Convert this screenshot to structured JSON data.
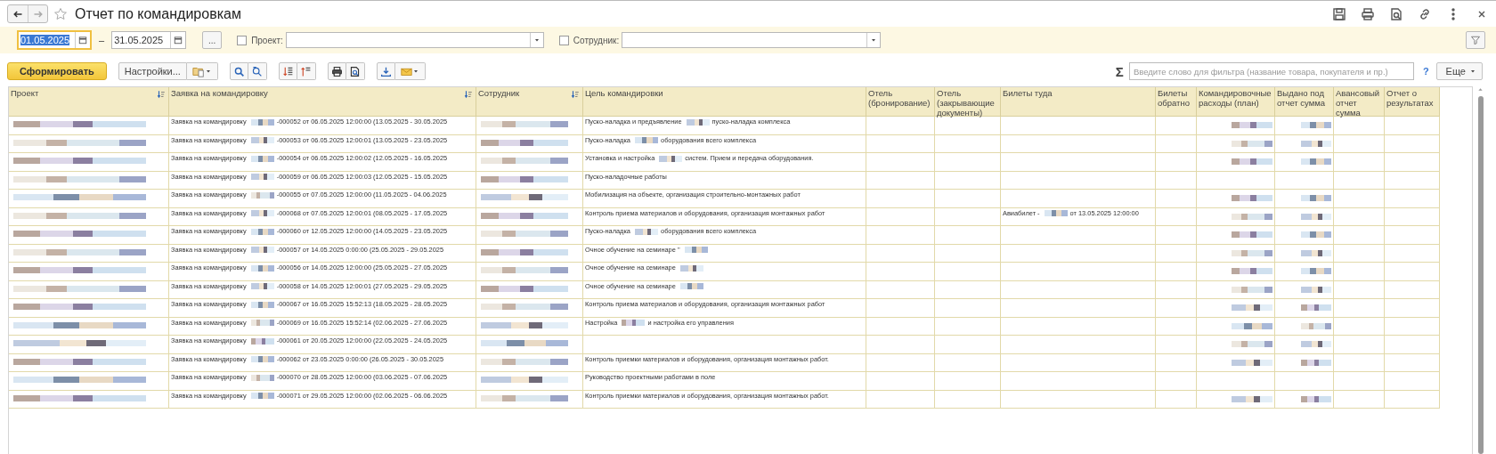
{
  "window": {
    "title": "Отчет по командировкам"
  },
  "filters": {
    "date_from": {
      "value": "01.05.2025",
      "highlighted": true
    },
    "dash": "–",
    "date_to": {
      "value": "31.05.2025",
      "highlighted": false
    },
    "period_button": "...",
    "project": {
      "label": "Проект:",
      "checked": false
    },
    "employee": {
      "label": "Сотрудник:",
      "checked": false
    }
  },
  "toolbar": {
    "generate": "Сформировать",
    "settings": "Настройки...",
    "sigma": "Σ",
    "search_placeholder": "Введите слово для фильтра (название товара, покупателя и пр.)",
    "help": "?",
    "more": "Еще"
  },
  "table": {
    "columns": [
      {
        "label": "Проект",
        "sorted": true
      },
      {
        "label": "Заявка на командировку",
        "sorted": true
      },
      {
        "label": "Сотрудник",
        "sorted": true
      },
      {
        "label": "Цель командировки",
        "sorted": false
      },
      {
        "label": "Отель (бронирование)",
        "sorted": false
      },
      {
        "label": "Отель (закрывающие документы)",
        "sorted": false
      },
      {
        "label": "Билеты туда",
        "sorted": false
      },
      {
        "label": "Билеты обратно",
        "sorted": false
      },
      {
        "label": "Командировочные расходы (план)",
        "sorted": false
      },
      {
        "label": "Выдано под отчет сумма",
        "sorted": false
      },
      {
        "label": "Авансовый отчет сумма",
        "sorted": false
      },
      {
        "label": "Отчет о результатах",
        "sorted": false
      }
    ],
    "rows": [
      {
        "project_redacted": true,
        "request": [
          {
            "kind": "text",
            "text": "Заявка на командировку"
          },
          {
            "kind": "redacted"
          },
          {
            "kind": "text",
            "text": "-000052 от 06.05.2025 12:00:00 (13.05.2025 - 30.05.2025"
          }
        ],
        "employee_redacted": true,
        "purpose": [
          {
            "kind": "text",
            "text": "Пуско-наладка и предъявление"
          },
          {
            "kind": "redacted"
          },
          {
            "kind": "text",
            "text": "пуско-наладка комплекса"
          }
        ],
        "expenses_redacted": true,
        "issued_redacted": true
      },
      {
        "project_redacted": true,
        "request": [
          {
            "kind": "text",
            "text": "Заявка на командировку"
          },
          {
            "kind": "redacted"
          },
          {
            "kind": "text",
            "text": "-000053 от 06.05.2025 12:00:01 (13.05.2025 - 23.05.2025"
          }
        ],
        "employee_redacted": true,
        "purpose": [
          {
            "kind": "text",
            "text": "Пуско-наладка"
          },
          {
            "kind": "redacted"
          },
          {
            "kind": "text",
            "text": "оборудования всего комплекса"
          }
        ],
        "expenses_redacted": true,
        "issued_redacted": true
      },
      {
        "project_redacted": true,
        "request": [
          {
            "kind": "text",
            "text": "Заявка на командировку"
          },
          {
            "kind": "redacted"
          },
          {
            "kind": "text",
            "text": "-000054 от 06.05.2025 12:00:02 (12.05.2025 - 16.05.2025"
          }
        ],
        "employee_redacted": true,
        "purpose": [
          {
            "kind": "text",
            "text": "Установка и настройка"
          },
          {
            "kind": "redacted"
          },
          {
            "kind": "text",
            "text": "систем. Прием и передача оборудования."
          }
        ],
        "expenses_redacted": true,
        "issued_redacted": true
      },
      {
        "project_redacted": true,
        "request": [
          {
            "kind": "text",
            "text": "Заявка на командировку"
          },
          {
            "kind": "redacted"
          },
          {
            "kind": "text",
            "text": "-000059 от 06.05.2025 12:00:03 (12.05.2025 - 15.05.2025"
          }
        ],
        "employee_redacted": true,
        "purpose": [
          {
            "kind": "text",
            "text": "Пуско-наладочные работы"
          }
        ],
        "expenses_redacted": false,
        "issued_redacted": false
      },
      {
        "project_redacted": true,
        "request": [
          {
            "kind": "text",
            "text": "Заявка на командировку"
          },
          {
            "kind": "redacted"
          },
          {
            "kind": "text",
            "text": "-000055 от 07.05.2025 12:00:00 (11.05.2025 - 04.06.2025"
          }
        ],
        "employee_redacted": true,
        "purpose": [
          {
            "kind": "text",
            "text": "Мобилизация на объекте, организация строительно-монтажных работ"
          }
        ],
        "expenses_redacted": true,
        "issued_redacted": true
      },
      {
        "project_redacted": true,
        "request": [
          {
            "kind": "text",
            "text": "Заявка на командировку"
          },
          {
            "kind": "redacted"
          },
          {
            "kind": "text",
            "text": "-000068 от 07.05.2025 12:00:01 (08.05.2025 - 17.05.2025"
          }
        ],
        "employee_redacted": true,
        "purpose": [
          {
            "kind": "text",
            "text": "Контроль приема материалов и оборудования, организация монтажных работ"
          }
        ],
        "tickets_out": [
          {
            "kind": "text",
            "text": "Авиабилет -"
          },
          {
            "kind": "redacted"
          },
          {
            "kind": "text",
            "text": "от 13.05.2025 12:00:00"
          }
        ],
        "expenses_redacted": true,
        "issued_redacted": true
      },
      {
        "project_redacted": true,
        "request": [
          {
            "kind": "text",
            "text": "Заявка на командировку"
          },
          {
            "kind": "redacted"
          },
          {
            "kind": "text",
            "text": "-000060 от 12.05.2025 12:00:00 (14.05.2025 - 23.05.2025"
          }
        ],
        "employee_redacted": true,
        "purpose": [
          {
            "kind": "text",
            "text": "Пуско-наладка"
          },
          {
            "kind": "redacted"
          },
          {
            "kind": "text",
            "text": "оборудования всего комплекса"
          }
        ],
        "expenses_redacted": true,
        "issued_redacted": true
      },
      {
        "project_redacted": true,
        "request": [
          {
            "kind": "text",
            "text": "Заявка на командировку"
          },
          {
            "kind": "redacted"
          },
          {
            "kind": "text",
            "text": "-000057 от 14.05.2025 0:00:00 (25.05.2025 - 29.05.2025"
          }
        ],
        "employee_redacted": true,
        "purpose": [
          {
            "kind": "text",
            "text": "Очное обучение на семинаре \""
          },
          {
            "kind": "redacted"
          }
        ],
        "expenses_redacted": true,
        "issued_redacted": true
      },
      {
        "project_redacted": true,
        "request": [
          {
            "kind": "text",
            "text": "Заявка на командировку"
          },
          {
            "kind": "redacted"
          },
          {
            "kind": "text",
            "text": "-000056 от 14.05.2025 12:00:00 (25.05.2025 - 27.05.2025"
          }
        ],
        "employee_redacted": true,
        "purpose": [
          {
            "kind": "text",
            "text": "Очное обучение на семинаре"
          },
          {
            "kind": "redacted"
          }
        ],
        "expenses_redacted": true,
        "issued_redacted": true
      },
      {
        "project_redacted": true,
        "request": [
          {
            "kind": "text",
            "text": "Заявка на командировку"
          },
          {
            "kind": "redacted"
          },
          {
            "kind": "text",
            "text": "-000058 от 14.05.2025 12:00:01 (27.05.2025 - 29.05.2025"
          }
        ],
        "employee_redacted": true,
        "purpose": [
          {
            "kind": "text",
            "text": "Очное обучение на семинаре"
          },
          {
            "kind": "redacted"
          }
        ],
        "expenses_redacted": true,
        "issued_redacted": true
      },
      {
        "project_redacted": true,
        "request": [
          {
            "kind": "text",
            "text": "Заявка на командировку"
          },
          {
            "kind": "redacted"
          },
          {
            "kind": "text",
            "text": "-000067 от 16.05.2025 15:52:13 (18.05.2025 - 28.05.2025"
          }
        ],
        "employee_redacted": true,
        "purpose": [
          {
            "kind": "text",
            "text": "Контроль приема материалов и оборудования, организация монтажных работ"
          }
        ],
        "expenses_redacted": true,
        "issued_redacted": true
      },
      {
        "project_redacted": true,
        "request": [
          {
            "kind": "text",
            "text": "Заявка на командировку"
          },
          {
            "kind": "redacted"
          },
          {
            "kind": "text",
            "text": "-000069 от 16.05.2025 15:52:14 (02.06.2025 - 27.06.2025"
          }
        ],
        "employee_redacted": true,
        "purpose": [
          {
            "kind": "text",
            "text": "Настройка"
          },
          {
            "kind": "redacted"
          },
          {
            "kind": "text",
            "text": "и настройка его управления"
          }
        ],
        "expenses_redacted": true,
        "issued_redacted": true
      },
      {
        "project_redacted": true,
        "request": [
          {
            "kind": "text",
            "text": "Заявка на командировку"
          },
          {
            "kind": "redacted"
          },
          {
            "kind": "text",
            "text": "-000061 от 20.05.2025 12:00:00 (22.05.2025 - 24.05.2025"
          }
        ],
        "employee_redacted": true,
        "purpose": [],
        "expenses_redacted": true,
        "issued_redacted": true
      },
      {
        "project_redacted": true,
        "request": [
          {
            "kind": "text",
            "text": "Заявка на командировку"
          },
          {
            "kind": "redacted"
          },
          {
            "kind": "text",
            "text": "-000062 от 23.05.2025 0:00:00 (26.05.2025 - 30.05.2025"
          }
        ],
        "employee_redacted": true,
        "purpose": [
          {
            "kind": "text",
            "text": "Контроль приемки материалов и оборудования, организация монтажных работ."
          }
        ],
        "expenses_redacted": true,
        "issued_redacted": true
      },
      {
        "project_redacted": true,
        "request": [
          {
            "kind": "text",
            "text": "Заявка на командировку"
          },
          {
            "kind": "redacted"
          },
          {
            "kind": "text",
            "text": "-000070 от 28.05.2025 12:00:00 (03.06.2025 - 07.06.2025"
          }
        ],
        "employee_redacted": true,
        "purpose": [
          {
            "kind": "text",
            "text": "Руководство проектными работами в поле"
          }
        ],
        "expenses_redacted": false,
        "issued_redacted": false
      },
      {
        "project_redacted": true,
        "request": [
          {
            "kind": "text",
            "text": "Заявка на командировку"
          },
          {
            "kind": "redacted"
          },
          {
            "kind": "text",
            "text": "-000071 от 29.05.2025 12:00:00 (02.06.2025 - 06.06.2025"
          }
        ],
        "employee_redacted": true,
        "purpose": [
          {
            "kind": "text",
            "text": "Контроль приемки материалов и оборудования, организация монтажных работ."
          }
        ],
        "expenses_redacted": true,
        "issued_redacted": true
      }
    ]
  }
}
